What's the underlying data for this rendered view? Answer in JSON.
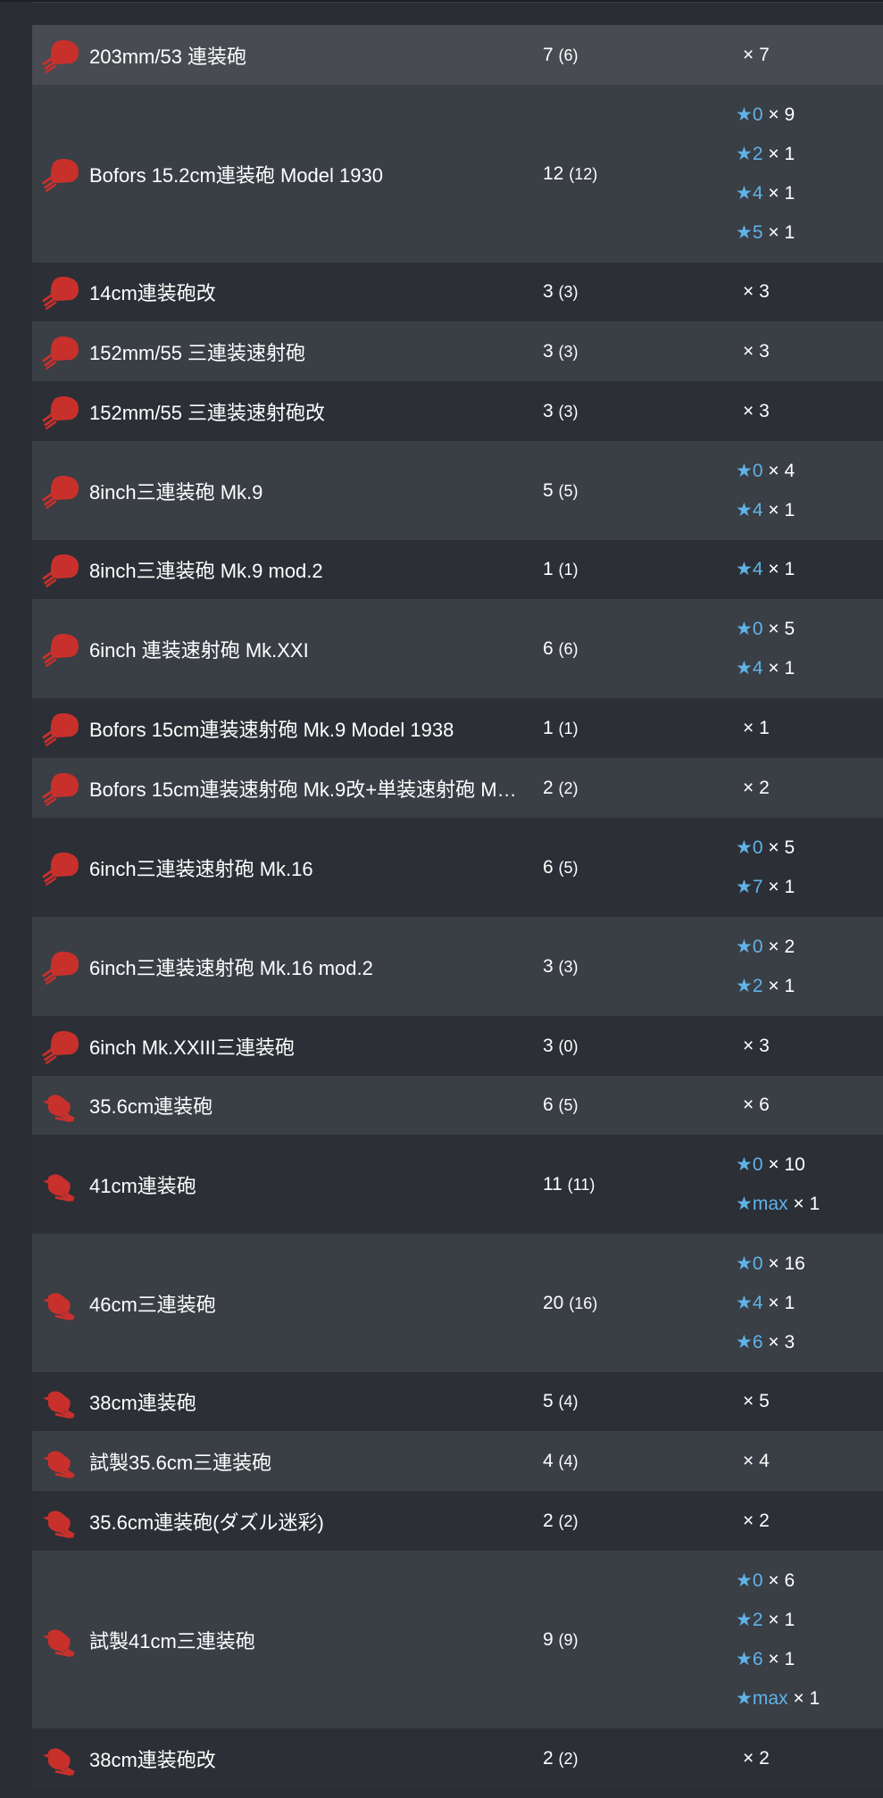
{
  "colors": {
    "accent_star": "#5fb3e8",
    "icon_red": "#c8302c"
  },
  "rows": [
    {
      "name": "203mm/53 連装砲",
      "total": "7",
      "sub": "(6)",
      "icon": "twin-gun-turret-icon",
      "stars": [
        {
          "lvl": "",
          "mult": "× 7"
        }
      ]
    },
    {
      "name": "Bofors 15.2cm連装砲 Model 1930",
      "total": "12",
      "sub": "(12)",
      "icon": "twin-gun-turret-icon",
      "stars": [
        {
          "lvl": "★0",
          "mult": "× 9"
        },
        {
          "lvl": "★2",
          "mult": "× 1"
        },
        {
          "lvl": "★4",
          "mult": "× 1"
        },
        {
          "lvl": "★5",
          "mult": "× 1"
        }
      ]
    },
    {
      "name": "14cm連装砲改",
      "total": "3",
      "sub": "(3)",
      "icon": "twin-gun-turret-icon",
      "stars": [
        {
          "lvl": "",
          "mult": "× 3"
        }
      ]
    },
    {
      "name": "152mm/55 三連装速射砲",
      "total": "3",
      "sub": "(3)",
      "icon": "twin-gun-turret-icon",
      "stars": [
        {
          "lvl": "",
          "mult": "× 3"
        }
      ]
    },
    {
      "name": "152mm/55 三連装速射砲改",
      "total": "3",
      "sub": "(3)",
      "icon": "twin-gun-turret-icon",
      "stars": [
        {
          "lvl": "",
          "mult": "× 3"
        }
      ]
    },
    {
      "name": "8inch三連装砲 Mk.9",
      "total": "5",
      "sub": "(5)",
      "icon": "twin-gun-turret-icon",
      "stars": [
        {
          "lvl": "★0",
          "mult": "× 4"
        },
        {
          "lvl": "★4",
          "mult": "× 1"
        }
      ]
    },
    {
      "name": "8inch三連装砲 Mk.9 mod.2",
      "total": "1",
      "sub": "(1)",
      "icon": "twin-gun-turret-icon",
      "stars": [
        {
          "lvl": "★4",
          "mult": "× 1"
        }
      ]
    },
    {
      "name": "6inch 連装速射砲 Mk.XXI",
      "total": "6",
      "sub": "(6)",
      "icon": "twin-gun-turret-icon",
      "stars": [
        {
          "lvl": "★0",
          "mult": "× 5"
        },
        {
          "lvl": "★4",
          "mult": "× 1"
        }
      ]
    },
    {
      "name": "Bofors 15cm連装速射砲 Mk.9 Model 1938",
      "total": "1",
      "sub": "(1)",
      "icon": "twin-gun-turret-icon",
      "stars": [
        {
          "lvl": "",
          "mult": "× 1"
        }
      ]
    },
    {
      "name": "Bofors 15cm連装速射砲 Mk.9改+単装速射砲 M…",
      "total": "2",
      "sub": "(2)",
      "icon": "twin-gun-turret-icon",
      "stars": [
        {
          "lvl": "",
          "mult": "× 2"
        }
      ]
    },
    {
      "name": "6inch三連装速射砲 Mk.16",
      "total": "6",
      "sub": "(5)",
      "icon": "twin-gun-turret-icon",
      "stars": [
        {
          "lvl": "★0",
          "mult": "× 5"
        },
        {
          "lvl": "★7",
          "mult": "× 1"
        }
      ]
    },
    {
      "name": "6inch三連装速射砲 Mk.16 mod.2",
      "total": "3",
      "sub": "(3)",
      "icon": "twin-gun-turret-icon",
      "stars": [
        {
          "lvl": "★0",
          "mult": "× 2"
        },
        {
          "lvl": "★2",
          "mult": "× 1"
        }
      ]
    },
    {
      "name": "6inch Mk.XXIII三連装砲",
      "total": "3",
      "sub": "(0)",
      "icon": "twin-gun-turret-icon",
      "stars": [
        {
          "lvl": "",
          "mult": "× 3"
        }
      ]
    },
    {
      "name": "35.6cm連装砲",
      "total": "6",
      "sub": "(5)",
      "icon": "triple-gun-turret-icon",
      "stars": [
        {
          "lvl": "",
          "mult": "× 6"
        }
      ]
    },
    {
      "name": "41cm連装砲",
      "total": "11",
      "sub": "(11)",
      "icon": "triple-gun-turret-icon",
      "stars": [
        {
          "lvl": "★0",
          "mult": "× 10"
        },
        {
          "lvl": "★max",
          "mult": "× 1"
        }
      ]
    },
    {
      "name": "46cm三連装砲",
      "total": "20",
      "sub": "(16)",
      "icon": "triple-gun-turret-icon",
      "stars": [
        {
          "lvl": "★0",
          "mult": "× 16"
        },
        {
          "lvl": "★4",
          "mult": "× 1"
        },
        {
          "lvl": "★6",
          "mult": "× 3"
        }
      ]
    },
    {
      "name": "38cm連装砲",
      "total": "5",
      "sub": "(4)",
      "icon": "triple-gun-turret-icon",
      "stars": [
        {
          "lvl": "",
          "mult": "× 5"
        }
      ]
    },
    {
      "name": "試製35.6cm三連装砲",
      "total": "4",
      "sub": "(4)",
      "icon": "triple-gun-turret-icon",
      "stars": [
        {
          "lvl": "",
          "mult": "× 4"
        }
      ]
    },
    {
      "name": "35.6cm連装砲(ダズル迷彩)",
      "total": "2",
      "sub": "(2)",
      "icon": "triple-gun-turret-icon",
      "stars": [
        {
          "lvl": "",
          "mult": "× 2"
        }
      ]
    },
    {
      "name": "試製41cm三連装砲",
      "total": "9",
      "sub": "(9)",
      "icon": "triple-gun-turret-icon",
      "stars": [
        {
          "lvl": "★0",
          "mult": "× 6"
        },
        {
          "lvl": "★2",
          "mult": "× 1"
        },
        {
          "lvl": "★6",
          "mult": "× 1"
        },
        {
          "lvl": "★max",
          "mult": "× 1"
        }
      ]
    },
    {
      "name": "38cm連装砲改",
      "total": "2",
      "sub": "(2)",
      "icon": "triple-gun-turret-icon",
      "stars": [
        {
          "lvl": "",
          "mult": "× 2"
        }
      ]
    }
  ]
}
